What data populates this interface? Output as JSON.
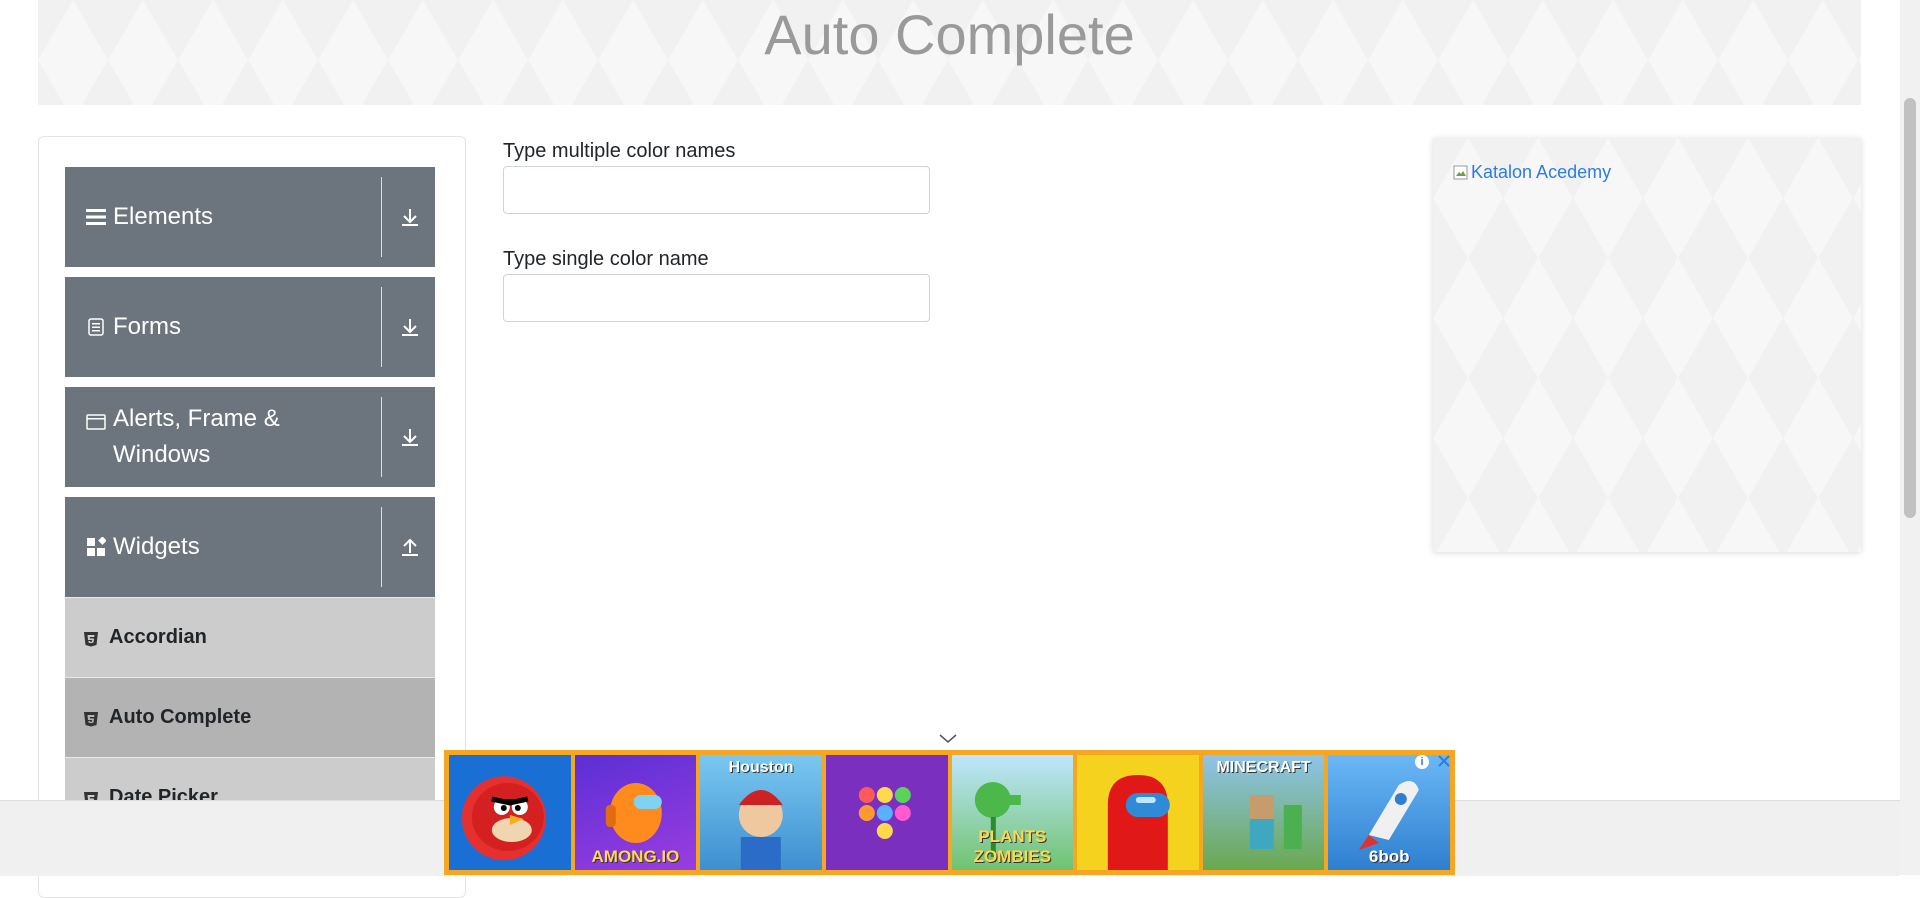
{
  "page": {
    "title": "Auto Complete"
  },
  "sidebar": {
    "groups": [
      {
        "label": "Elements",
        "icon": "menu-icon",
        "toggle": "download-arrow-icon"
      },
      {
        "label": "Forms",
        "icon": "form-icon",
        "toggle": "download-arrow-icon"
      },
      {
        "label": "Alerts, Frame & Windows",
        "icon": "window-icon",
        "toggle": "download-arrow-icon"
      },
      {
        "label": "Widgets",
        "icon": "widgets-icon",
        "toggle": "upload-arrow-icon"
      }
    ],
    "items": [
      {
        "label": "Accordian",
        "icon": "html5-icon"
      },
      {
        "label": "Auto Complete",
        "icon": "html5-icon",
        "active": true
      },
      {
        "label": "Date Picker",
        "icon": "html5-icon"
      }
    ]
  },
  "form": {
    "multi_label": "Type multiple color names",
    "multi_value": "",
    "single_label": "Type single color name",
    "single_value": ""
  },
  "ad": {
    "alt_text": "Katalon Acedemy",
    "icon": "broken-image-icon"
  },
  "game_ads": [
    {
      "name": "angry-birds",
      "label": ""
    },
    {
      "name": "among-io",
      "label": "AMONG.IO"
    },
    {
      "name": "houston",
      "label": "Houston"
    },
    {
      "name": "pop-it",
      "label": ""
    },
    {
      "name": "plants-vs-zombies",
      "label": "PLANTS ZOMBIES"
    },
    {
      "name": "among-us-red",
      "label": ""
    },
    {
      "name": "minecraft",
      "label": "MINECRAFT"
    },
    {
      "name": "6bob",
      "label": "6bob"
    }
  ],
  "colors": {
    "group_bg": "#6c757d",
    "item_bg": "#cccccc",
    "item_active_bg": "#b3b3b3",
    "link": "#2b7de0",
    "ad_border": "#f5a623"
  }
}
